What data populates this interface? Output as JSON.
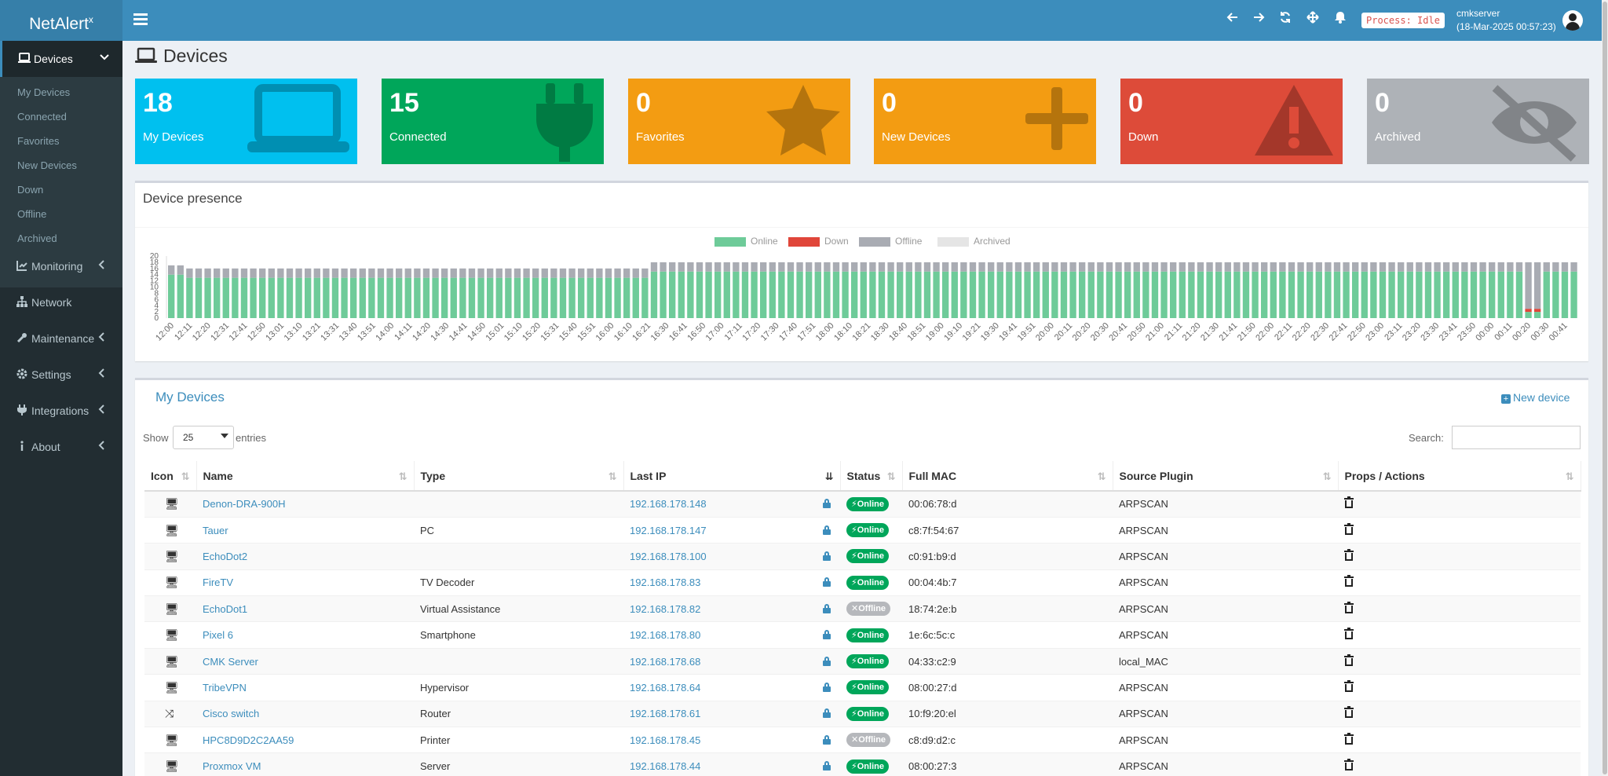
{
  "app": {
    "logo": "NetAlert",
    "logo_sup": "x",
    "process_status": "Process: Idle",
    "server_name": "cmkserver",
    "server_time": "(18-Mar-2025 00:57:23)"
  },
  "header_icons": [
    "arrow-left-icon",
    "arrow-right-icon",
    "refresh-icon",
    "move-icon",
    "bell-icon"
  ],
  "sidebar": {
    "devices_label": "Devices",
    "sub_items": [
      "My Devices",
      "Connected",
      "Favorites",
      "New Devices",
      "Down",
      "Offline",
      "Archived"
    ],
    "main_items": [
      {
        "label": "Monitoring",
        "icon": "chart-icon"
      },
      {
        "label": "Network",
        "icon": "network-icon"
      },
      {
        "label": "Maintenance",
        "icon": "wrench-icon"
      },
      {
        "label": "Settings",
        "icon": "gear-icon"
      },
      {
        "label": "Integrations",
        "icon": "plug-icon"
      },
      {
        "label": "About",
        "icon": "info-icon"
      }
    ]
  },
  "page_title": "Devices",
  "summary": [
    {
      "count": "18",
      "label": "My Devices",
      "color": "#00c0ef",
      "icon": "laptop-icon"
    },
    {
      "count": "15",
      "label": "Connected",
      "color": "#00a65a",
      "icon": "plug-icon"
    },
    {
      "count": "0",
      "label": "Favorites",
      "color": "#f39c12",
      "icon": "star-icon"
    },
    {
      "count": "0",
      "label": "New Devices",
      "color": "#f39c12",
      "icon": "plus-icon"
    },
    {
      "count": "0",
      "label": "Down",
      "color": "#dd4b39",
      "icon": "warning-icon"
    },
    {
      "count": "0",
      "label": "Archived",
      "color": "#aeb2b7",
      "icon": "eye-slash-icon"
    }
  ],
  "presence": {
    "title": "Device presence",
    "legend": [
      {
        "label": "Online",
        "color": "#6ecb99"
      },
      {
        "label": "Down",
        "color": "#e0463a"
      },
      {
        "label": "Offline",
        "color": "#a9acb3"
      },
      {
        "label": "Archived",
        "color": "#e5e5e5"
      }
    ]
  },
  "chart_data": {
    "type": "bar",
    "stacked": true,
    "ylim": [
      0,
      20
    ],
    "y_ticks": [
      "20",
      "18",
      "16",
      "14",
      "12",
      "10",
      "8",
      "6",
      "4",
      "2",
      "0"
    ],
    "x_tick_labels": [
      "12:00",
      "12:11",
      "12:20",
      "12:31",
      "12:41",
      "12:50",
      "13:01",
      "13:10",
      "13:21",
      "13:31",
      "13:40",
      "13:51",
      "14:00",
      "14:11",
      "14:20",
      "14:30",
      "14:41",
      "14:50",
      "15:01",
      "15:10",
      "15:20",
      "15:31",
      "15:40",
      "15:51",
      "16:00",
      "16:10",
      "16:21",
      "16:30",
      "16:41",
      "16:50",
      "17:00",
      "17:11",
      "17:20",
      "17:30",
      "17:40",
      "17:51",
      "18:00",
      "18:10",
      "18:21",
      "18:30",
      "18:40",
      "18:51",
      "19:00",
      "19:10",
      "19:21",
      "19:30",
      "19:41",
      "19:51",
      "20:00",
      "20:11",
      "20:20",
      "20:30",
      "20:41",
      "20:50",
      "21:00",
      "21:11",
      "21:20",
      "21:30",
      "21:41",
      "21:50",
      "22:00",
      "22:11",
      "22:20",
      "22:30",
      "22:41",
      "22:50",
      "23:00",
      "23:11",
      "23:20",
      "23:30",
      "23:41",
      "23:50",
      "00:00",
      "00:11",
      "00:20",
      "00:30",
      "00:41"
    ],
    "segments": [
      {
        "from": 0,
        "to": 2,
        "online": 14,
        "down": 0,
        "offline": 3
      },
      {
        "from": 2,
        "to": 53,
        "online": 13,
        "down": 0,
        "offline": 3
      },
      {
        "from": 53,
        "to": 149,
        "online": 15,
        "down": 0,
        "offline": 3
      },
      {
        "from": 149,
        "to": 151,
        "online": 2,
        "down": 1,
        "offline": 15
      },
      {
        "from": 151,
        "to": 155,
        "online": 15,
        "down": 0,
        "offline": 3
      }
    ],
    "bar_count": 155
  },
  "devices_section": {
    "title": "My Devices",
    "new_device": "New device",
    "show": "Show",
    "entries": "entries",
    "page_size": "25",
    "search_label": "Search:",
    "search_value": ""
  },
  "table": {
    "columns": [
      "Icon",
      "Name",
      "Type",
      "Last IP",
      "Status",
      "Full MAC",
      "Source Plugin",
      "Props / Actions"
    ],
    "rows": [
      {
        "icon": "🖥",
        "name": "Denon-DRA-900H",
        "type": "",
        "ip": "192.168.178.148",
        "status": "Online",
        "mac": "00:06:78:d",
        "plugin": "ARPSCAN"
      },
      {
        "icon": "🖥",
        "name": "Tauer",
        "type": "PC",
        "ip": "192.168.178.147",
        "status": "Online",
        "mac": "c8:7f:54:67",
        "plugin": "ARPSCAN"
      },
      {
        "icon": "🖥",
        "name": "EchoDot2",
        "type": "",
        "ip": "192.168.178.100",
        "status": "Online",
        "mac": "c0:91:b9:d",
        "plugin": "ARPSCAN"
      },
      {
        "icon": "🖥",
        "name": "FireTV",
        "type": "TV Decoder",
        "ip": "192.168.178.83",
        "status": "Online",
        "mac": "00:04:4b:7",
        "plugin": "ARPSCAN"
      },
      {
        "icon": "🖥",
        "name": "EchoDot1",
        "type": "Virtual Assistance",
        "ip": "192.168.178.82",
        "status": "Offline",
        "mac": "18:74:2e:b",
        "plugin": "ARPSCAN"
      },
      {
        "icon": "🖥",
        "name": "Pixel 6",
        "type": "Smartphone",
        "ip": "192.168.178.80",
        "status": "Online",
        "mac": "1e:6c:5c:c",
        "plugin": "ARPSCAN"
      },
      {
        "icon": "🖥",
        "name": "CMK Server",
        "type": "",
        "ip": "192.168.178.68",
        "status": "Online",
        "mac": "04:33:c2:9",
        "plugin": "local_MAC"
      },
      {
        "icon": "🖥",
        "name": "TribeVPN",
        "type": "Hypervisor",
        "ip": "192.168.178.64",
        "status": "Online",
        "mac": "08:00:27:d",
        "plugin": "ARPSCAN"
      },
      {
        "icon": "⤨",
        "name": "Cisco switch",
        "type": "Router",
        "ip": "192.168.178.61",
        "status": "Online",
        "mac": "10:f9:20:el",
        "plugin": "ARPSCAN"
      },
      {
        "icon": "🖥",
        "name": "HPC8D9D2C2AA59",
        "type": "Printer",
        "ip": "192.168.178.45",
        "status": "Offline",
        "mac": "c8:d9:d2:c",
        "plugin": "ARPSCAN"
      },
      {
        "icon": "🖥",
        "name": "Proxmox VM",
        "type": "Server",
        "ip": "192.168.178.44",
        "status": "Online",
        "mac": "08:00:27:3",
        "plugin": "ARPSCAN"
      }
    ]
  }
}
